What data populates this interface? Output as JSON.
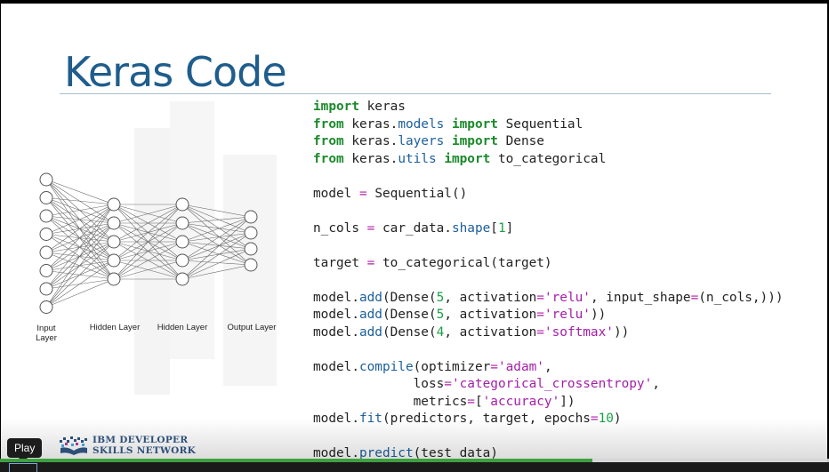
{
  "slide": {
    "title": "Keras Code",
    "layer_labels": [
      "Input\nLayer",
      "Hidden Layer",
      "Hidden Layer",
      "Output Layer"
    ],
    "network_layer_sizes": [
      8,
      5,
      5,
      4
    ]
  },
  "code_lines": [
    [
      [
        "kw",
        "import"
      ],
      [
        "t",
        " keras"
      ]
    ],
    [
      [
        "kw",
        "from"
      ],
      [
        "t",
        " keras."
      ],
      [
        "at",
        "models"
      ],
      [
        "t",
        " "
      ],
      [
        "kw",
        "import"
      ],
      [
        "t",
        " Sequential"
      ]
    ],
    [
      [
        "kw",
        "from"
      ],
      [
        "t",
        " keras."
      ],
      [
        "at",
        "layers"
      ],
      [
        "t",
        " "
      ],
      [
        "kw",
        "import"
      ],
      [
        "t",
        " Dense"
      ]
    ],
    [
      [
        "kw",
        "from"
      ],
      [
        "t",
        " keras."
      ],
      [
        "at",
        "utils"
      ],
      [
        "t",
        " "
      ],
      [
        "kw",
        "import"
      ],
      [
        "t",
        " to_categorical"
      ]
    ],
    [],
    [
      [
        "t",
        "model "
      ],
      [
        "op",
        "="
      ],
      [
        "t",
        " Sequential()"
      ]
    ],
    [],
    [
      [
        "t",
        "n_cols "
      ],
      [
        "op",
        "="
      ],
      [
        "t",
        " car_data."
      ],
      [
        "at",
        "shape"
      ],
      [
        "t",
        "["
      ],
      [
        "nm",
        "1"
      ],
      [
        "t",
        "]"
      ]
    ],
    [],
    [
      [
        "t",
        "target "
      ],
      [
        "op",
        "="
      ],
      [
        "t",
        " to_categorical(target)"
      ]
    ],
    [],
    [
      [
        "t",
        "model."
      ],
      [
        "at",
        "add"
      ],
      [
        "t",
        "(Dense("
      ],
      [
        "nm",
        "5"
      ],
      [
        "t",
        ", activation"
      ],
      [
        "op",
        "="
      ],
      [
        "st",
        "'relu'"
      ],
      [
        "t",
        ", input_shape"
      ],
      [
        "op",
        "="
      ],
      [
        "t",
        "(n_cols,)))"
      ]
    ],
    [
      [
        "t",
        "model."
      ],
      [
        "at",
        "add"
      ],
      [
        "t",
        "(Dense("
      ],
      [
        "nm",
        "5"
      ],
      [
        "t",
        ", activation"
      ],
      [
        "op",
        "="
      ],
      [
        "st",
        "'relu'"
      ],
      [
        "t",
        "))"
      ]
    ],
    [
      [
        "t",
        "model."
      ],
      [
        "at",
        "add"
      ],
      [
        "t",
        "(Dense("
      ],
      [
        "nm",
        "4"
      ],
      [
        "t",
        ", activation"
      ],
      [
        "op",
        "="
      ],
      [
        "st",
        "'softmax'"
      ],
      [
        "t",
        "))"
      ]
    ],
    [],
    [
      [
        "t",
        "model."
      ],
      [
        "at",
        "compile"
      ],
      [
        "t",
        "(optimizer"
      ],
      [
        "op",
        "="
      ],
      [
        "st",
        "'adam'"
      ],
      [
        "t",
        ","
      ]
    ],
    [
      [
        "t",
        "             loss"
      ],
      [
        "op",
        "="
      ],
      [
        "st",
        "'categorical_crossentropy'"
      ],
      [
        "t",
        ","
      ]
    ],
    [
      [
        "t",
        "             metrics"
      ],
      [
        "op",
        "="
      ],
      [
        "t",
        "["
      ],
      [
        "st",
        "'accuracy'"
      ],
      [
        "t",
        "])"
      ]
    ],
    [
      [
        "t",
        "model."
      ],
      [
        "at",
        "fit"
      ],
      [
        "t",
        "(predictors, target, epochs"
      ],
      [
        "op",
        "="
      ],
      [
        "nm",
        "10"
      ],
      [
        "t",
        ")"
      ]
    ],
    [],
    [
      [
        "t",
        "model."
      ],
      [
        "at",
        "predict"
      ],
      [
        "t",
        "(test_data)"
      ]
    ]
  ],
  "branding": {
    "logo_line1": "IBM DEVELOPER",
    "logo_line2": "SKILLS NETWORK"
  },
  "player": {
    "tooltip": "Play",
    "progress_played_fraction": 0.715,
    "progress_loaded_fraction": 0.715
  },
  "colors": {
    "title": "#1f5d8c",
    "keyword": "#1a8a2a",
    "attribute": "#1c5f9c",
    "string": "#a51ea8",
    "number": "#18a043",
    "progress": "#3fa03f"
  }
}
